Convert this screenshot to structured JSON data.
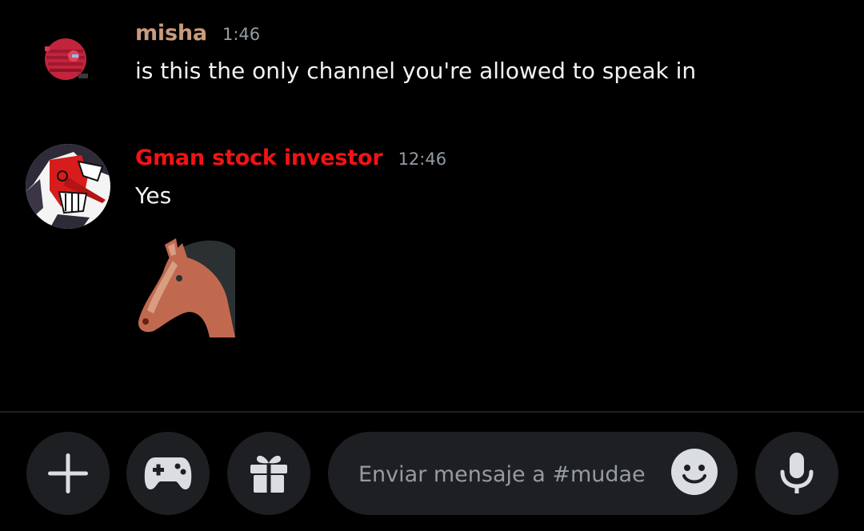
{
  "messages": [
    {
      "username": "misha",
      "username_color": "#c99b7c",
      "timestamp": "1:46",
      "text": "is this the only channel you're allowed to speak in",
      "avatar": "pixel-red-creature-avatar"
    },
    {
      "username": "Gman stock investor",
      "username_color": "#f21313",
      "timestamp": "12:46",
      "text": "Yes",
      "avatar": "red-masked-face-avatar",
      "attachment_emoji": "horse-face-emoji"
    }
  ],
  "composer": {
    "placeholder": "Enviar mensaje a #mudae"
  },
  "toolbar": {
    "buttons": [
      "plus-icon",
      "gamepad-icon",
      "gift-icon",
      "microphone-icon"
    ]
  },
  "colors": {
    "background": "#000000",
    "surface": "#1e1f22",
    "muted_text": "#949ba4",
    "primary_text": "#f2f3f5"
  }
}
